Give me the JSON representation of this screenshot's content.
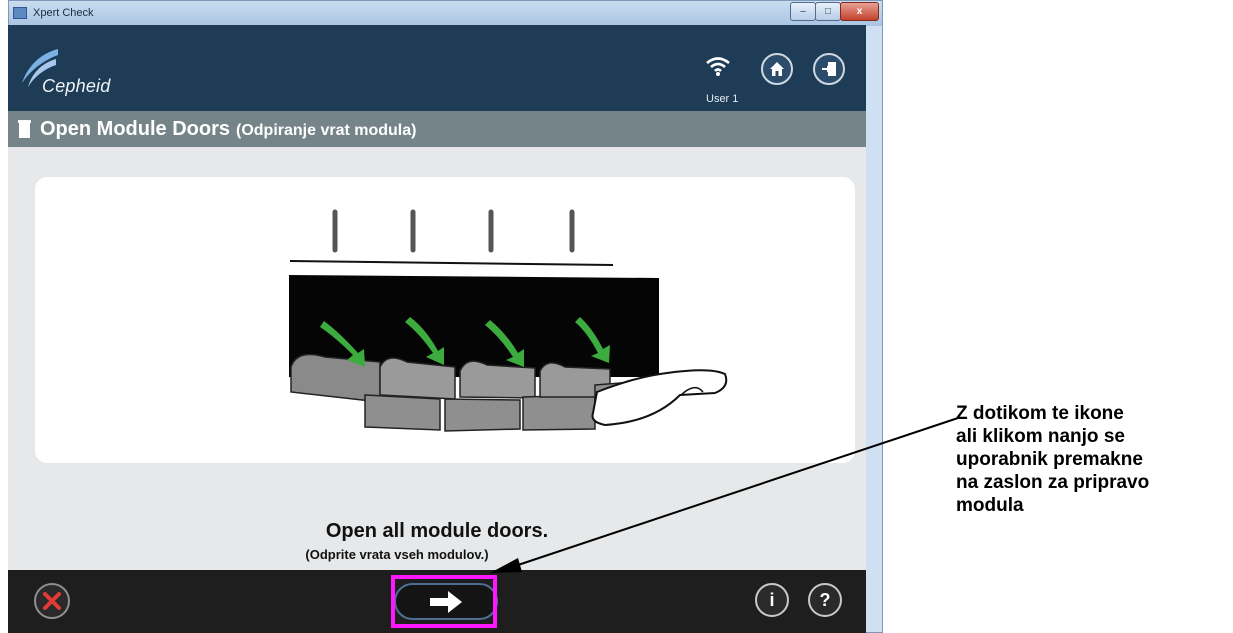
{
  "window": {
    "title": "Xpert Check",
    "controls": [
      "–",
      "□",
      "x"
    ]
  },
  "header": {
    "logo_text": "Cepheid",
    "user_label": "User 1",
    "icons": [
      "wifi-icon",
      "home-icon",
      "exit-icon"
    ]
  },
  "section": {
    "title": "Open Module Doors",
    "subtitle": "(Odpiranje vrat modula)"
  },
  "instruction": {
    "main": "Open all module doors.",
    "sub": "(Odprite vrata vseh modulov.)"
  },
  "footer": {
    "cancel_icon": "cancel-x-icon",
    "next_icon": "arrow-right-icon",
    "info_label": "i",
    "help_label": "?"
  },
  "annotation": {
    "text": "Z dotikom te ikone\nali klikom nanjo se\nuporabnik premakne\nna zaslon za pripravo\nmodula"
  },
  "colors": {
    "header_bg": "#1f3c57",
    "section_bg": "#748489",
    "footer_bg": "#1e1e1f",
    "highlight": "#ff17ff",
    "arrow_green": "#3dac3f"
  }
}
